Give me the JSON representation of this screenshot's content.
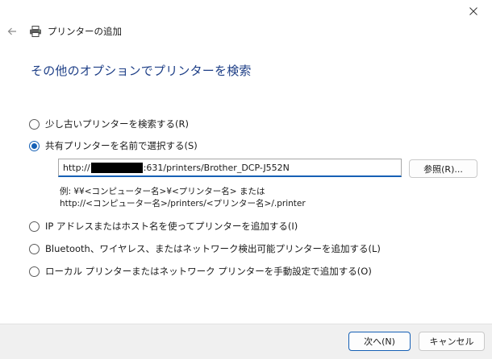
{
  "window": {
    "title": "プリンターの追加",
    "close_icon": "close-icon",
    "back_icon": "back-arrow-icon",
    "printer_icon": "printer-icon"
  },
  "heading": "その他のオプションでプリンターを検索",
  "options": [
    {
      "label": "少し古いプリンターを検索する(R)",
      "checked": false
    },
    {
      "label": "共有プリンターを名前で選択する(S)",
      "checked": true
    },
    {
      "label": "IP アドレスまたはホスト名を使ってプリンターを追加する(I)",
      "checked": false
    },
    {
      "label": "Bluetooth、ワイヤレス、またはネットワーク検出可能プリンターを追加する(L)",
      "checked": false
    },
    {
      "label": "ローカル プリンターまたはネットワーク プリンターを手動設定で追加する(O)",
      "checked": false
    }
  ],
  "shared_printer": {
    "url_prefix": "http://",
    "url_suffix": ":631/printers/Brother_DCP-J552N",
    "browse_label": "参照(R)...",
    "example_line1": "例: ¥¥<コンピューター名>¥<プリンター名> または",
    "example_line2": "http://<コンピューター名>/printers/<プリンター名>/.printer"
  },
  "footer": {
    "next_label": "次へ(N)",
    "cancel_label": "キャンセル"
  },
  "colors": {
    "accent": "#1660b5",
    "heading": "#1e3f87",
    "footer_bg": "#f0f0f0"
  }
}
